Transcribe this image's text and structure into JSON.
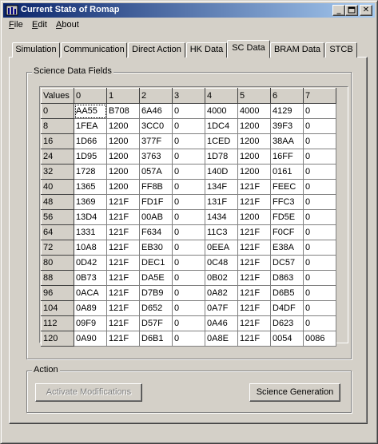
{
  "window": {
    "title": "Current State of Romap"
  },
  "menu": [
    {
      "label": "File",
      "mnemonic": "F"
    },
    {
      "label": "Edit",
      "mnemonic": "E"
    },
    {
      "label": "About",
      "mnemonic": "A"
    }
  ],
  "tabs": [
    "Simulation",
    "Communication",
    "Direct Action",
    "HK Data",
    "SC Data",
    "BRAM Data",
    "STCB"
  ],
  "active_tab": "SC Data",
  "science": {
    "group_label": "Science Data Fields",
    "headers": [
      "Values",
      "0",
      "1",
      "2",
      "3",
      "4",
      "5",
      "6",
      "7"
    ],
    "rows": [
      [
        "0",
        "AA55",
        "B708",
        "6A46",
        "0",
        "4000",
        "4000",
        "4129",
        "0"
      ],
      [
        "8",
        "1FEA",
        "1200",
        "3CC0",
        "0",
        "1DC4",
        "1200",
        "39F3",
        "0"
      ],
      [
        "16",
        "1D66",
        "1200",
        "377F",
        "0",
        "1CED",
        "1200",
        "38AA",
        "0"
      ],
      [
        "24",
        "1D95",
        "1200",
        "3763",
        "0",
        "1D78",
        "1200",
        "16FF",
        "0"
      ],
      [
        "32",
        "1728",
        "1200",
        "057A",
        "0",
        "140D",
        "1200",
        "0161",
        "0"
      ],
      [
        "40",
        "1365",
        "1200",
        "FF8B",
        "0",
        "134F",
        "121F",
        "FEEC",
        "0"
      ],
      [
        "48",
        "1369",
        "121F",
        "FD1F",
        "0",
        "131F",
        "121F",
        "FFC3",
        "0"
      ],
      [
        "56",
        "13D4",
        "121F",
        "00AB",
        "0",
        "1434",
        "1200",
        "FD5E",
        "0"
      ],
      [
        "64",
        "1331",
        "121F",
        "F634",
        "0",
        "11C3",
        "121F",
        "F0CF",
        "0"
      ],
      [
        "72",
        "10A8",
        "121F",
        "EB30",
        "0",
        "0EEA",
        "121F",
        "E38A",
        "0"
      ],
      [
        "80",
        "0D42",
        "121F",
        "DEC1",
        "0",
        "0C48",
        "121F",
        "DC57",
        "0"
      ],
      [
        "88",
        "0B73",
        "121F",
        "DA5E",
        "0",
        "0B02",
        "121F",
        "D863",
        "0"
      ],
      [
        "96",
        "0ACA",
        "121F",
        "D7B9",
        "0",
        "0A82",
        "121F",
        "D6B5",
        "0"
      ],
      [
        "104",
        "0A89",
        "121F",
        "D652",
        "0",
        "0A7F",
        "121F",
        "D4DF",
        "0"
      ],
      [
        "112",
        "09F9",
        "121F",
        "D57F",
        "0",
        "0A46",
        "121F",
        "D623",
        "0"
      ],
      [
        "120",
        "0A90",
        "121F",
        "D6B1",
        "0",
        "0A8E",
        "121F",
        "0054",
        "0086"
      ]
    ]
  },
  "action": {
    "group_label": "Action",
    "activate_label": "Activate  Modifications",
    "science_label": "Science Generation"
  },
  "colors": {
    "title_start": "#0a246a",
    "title_end": "#a6caf0",
    "face": "#d4d0c8"
  }
}
